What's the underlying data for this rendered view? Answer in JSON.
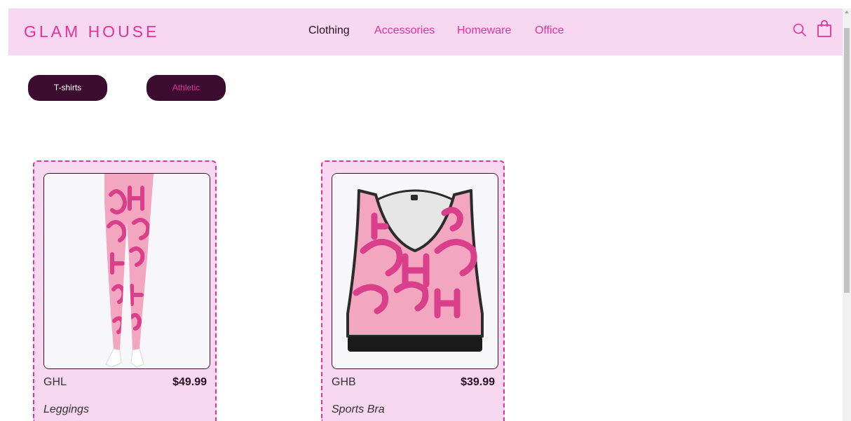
{
  "header": {
    "logo": "GLAM HOUSE",
    "nav": [
      {
        "label": "Clothing",
        "active": true
      },
      {
        "label": "Accessories",
        "active": false
      },
      {
        "label": "Homeware",
        "active": false
      },
      {
        "label": "Office",
        "active": false
      }
    ],
    "icons": [
      "search-icon",
      "shopping-bag-icon"
    ]
  },
  "filters": [
    {
      "label": "T-shirts",
      "selected": false
    },
    {
      "label": "Athletic",
      "selected": true
    }
  ],
  "products": [
    {
      "code": "GHL",
      "price": "$49.99",
      "name": "Leggings",
      "image": "leggings-image"
    },
    {
      "code": "GHB",
      "price": "$39.99",
      "name": "Sports Bra",
      "image": "sports-bra-image"
    }
  ],
  "colors": {
    "accent": "#e0339c",
    "header_bg": "#f8d7f1",
    "pill_bg": "#3b0b30",
    "product_pink": "#f3a6bf",
    "product_pattern": "#d93f8a"
  }
}
